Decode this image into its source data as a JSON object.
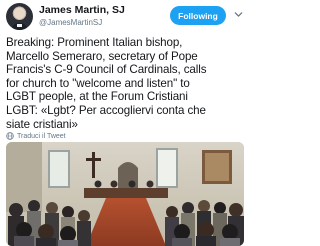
{
  "author": {
    "display_name": "James Martin, SJ",
    "handle": "@JamesMartinSJ"
  },
  "follow": {
    "label": "Following"
  },
  "tweet": {
    "text": "Breaking: Prominent Italian bishop,\nMarcello Semeraro, secretary of Pope\nFrancis's C-9 Council of Cardinals, calls\nfor church to \"welcome and listen\" to\nLGBT people, at the Forum Cristiani\nLGBT: «Lgbt? Per accogliervi conta che\nsiate cristiani»",
    "translate_label": "Traduci il Tweet"
  },
  "icons": {
    "avatar": "avatar-photo",
    "chevron": "chevron-down-icon",
    "translate": "globe-icon"
  },
  "colors": {
    "accent": "#1da1f2",
    "secondary_text": "#657786"
  }
}
